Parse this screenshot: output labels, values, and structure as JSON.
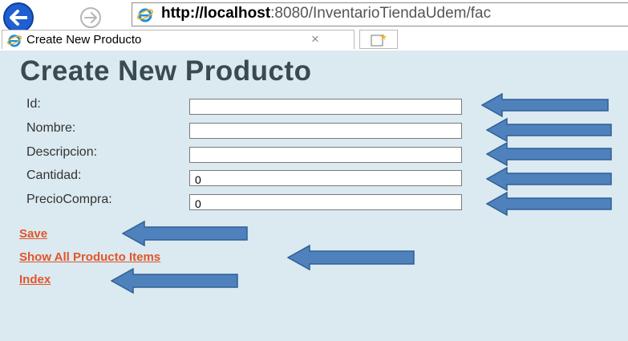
{
  "browser": {
    "address_host": "http://localhost",
    "address_rest": ":8080/InventarioTiendaUdem/fac",
    "tab_title": "Create New Producto",
    "tab_close": "×"
  },
  "page": {
    "title": "Create New Producto",
    "fields": [
      {
        "label": "Id:",
        "value": ""
      },
      {
        "label": "Nombre:",
        "value": ""
      },
      {
        "label": "Descripcion:",
        "value": ""
      },
      {
        "label": "Cantidad:",
        "value": "0"
      },
      {
        "label": "PrecioCompra:",
        "value": "0"
      }
    ],
    "links": {
      "save": "Save",
      "show_all": "Show All Producto Items",
      "index": "Index"
    }
  },
  "colors": {
    "page_background": "#dbe9f0",
    "link": "#e0562a",
    "annotation_arrow": "#4f81bd",
    "title": "#3a4a51"
  }
}
